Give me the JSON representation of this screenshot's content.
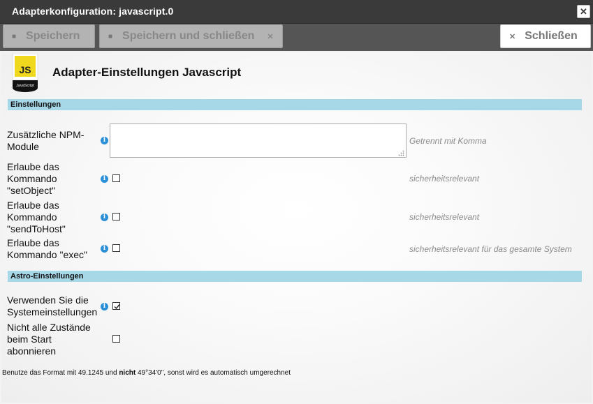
{
  "window": {
    "title": "Adapterkonfiguration: javascript.0",
    "close_glyph": "✕"
  },
  "toolbar": {
    "save_label": "Speichern",
    "save_close_label": "Speichern und schließen",
    "close_label": "Schließen"
  },
  "header": {
    "logo_text": "JS",
    "logo_caption": "JavaScript",
    "title": "Adapter-Einstellungen Javascript"
  },
  "sections": {
    "settings": "Einstellungen",
    "astro": "Astro-Einstellungen"
  },
  "fields": {
    "npm": {
      "label": "Zusätzliche NPM-Module",
      "value": "",
      "hint": "Getrennt mit Komma"
    },
    "setobject": {
      "label": "Erlaube das Kommando \"setObject\"",
      "checked": false,
      "hint": "sicherheitsrelevant"
    },
    "sendtohost": {
      "label": "Erlaube das Kommando \"sendToHost\"",
      "checked": false,
      "hint": "sicherheitsrelevant"
    },
    "exec": {
      "label": "Erlaube das Kommando \"exec\"",
      "checked": false,
      "hint": "sicherheitsrelevant für das gesamte System"
    },
    "system_settings": {
      "label": "Verwenden Sie die Systemeinstellungen",
      "checked": true
    },
    "no_subscribe": {
      "label": "Nicht alle Zustände beim Start abonnieren",
      "checked": false
    }
  },
  "footnote": {
    "pre": "Benutze das Format mit 49.1245 und ",
    "bold": "nicht",
    "post": " 49°34'0\", sonst wird es automatisch umgerechnet"
  },
  "colors": {
    "section_bg": "#a7d8e8",
    "info_icon": "#2a8fd6",
    "titlebar": "#3a3a3a",
    "toolbar": "#555555"
  },
  "icons": {
    "info": "info-icon",
    "save": "save-icon",
    "close": "close-icon"
  }
}
